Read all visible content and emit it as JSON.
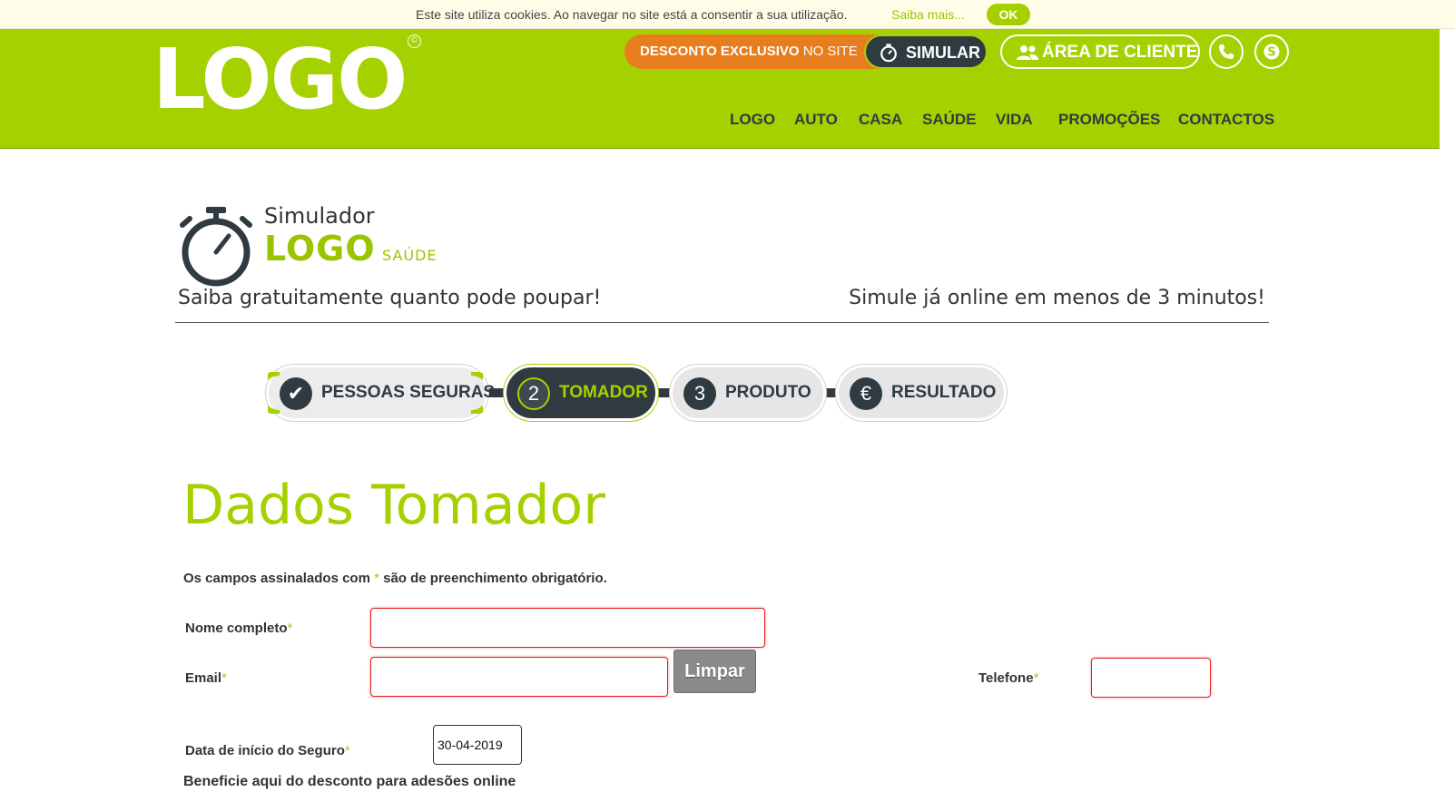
{
  "cookie_bar": {
    "text": "Este site utiliza cookies. Ao navegar no site está a consentir a sua utilização.",
    "link": "Saiba mais...",
    "ok": "OK"
  },
  "header": {
    "logo": "LOGO",
    "logo_mark": "©",
    "discount_bold": "DESCONTO EXCLUSIVO",
    "discount_light": " NO SITE",
    "simular": "SIMULAR",
    "client_area": "ÁREA DE CLIENTE",
    "nav": [
      "LOGO",
      "AUTO",
      "CASA",
      "SAÚDE",
      "VIDA",
      "PROMOÇÕES",
      "CONTACTOS"
    ]
  },
  "simulator": {
    "word": "Simulador",
    "brand": "LOGO",
    "product": "SAÚDE",
    "tagline_left": "Saiba gratuitamente quanto pode poupar!",
    "tagline_right": "Simule já online em menos de 3 minutos!"
  },
  "steps": [
    {
      "label": "PESSOAS SEGURAS",
      "marker": "✔",
      "state": "done"
    },
    {
      "label": "TOMADOR",
      "marker": "2",
      "state": "active"
    },
    {
      "label": "PRODUTO",
      "marker": "3",
      "state": "pending"
    },
    {
      "label": "RESULTADO",
      "marker": "€",
      "state": "pending"
    }
  ],
  "form": {
    "title": "Dados Tomador",
    "required_note_pre": "Os campos assinalados com ",
    "required_star": "*",
    "required_note_post": " são de preenchimento obrigatório.",
    "fields": {
      "name_label": "Nome completo",
      "name_value": "",
      "email_label": "Email",
      "email_value": "",
      "phone_label": "Telefone",
      "phone_value": "",
      "start_date_label": "Data de início do Seguro",
      "start_date_value": "30-04-2019"
    },
    "clear_button": "Limpar",
    "benefit_text": "Beneficie aqui do desconto para adesões online"
  },
  "colors": {
    "brand_green": "#a6d100",
    "dark": "#2f3b41",
    "orange": "#e87d1e",
    "error_red": "#e21b1b"
  }
}
